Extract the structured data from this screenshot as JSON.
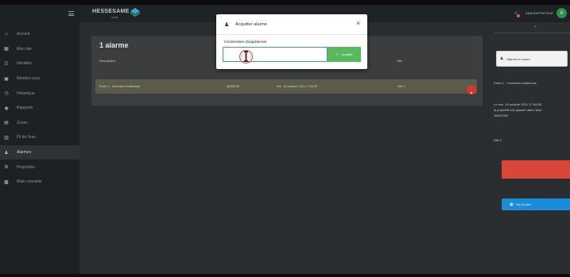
{
  "app": {
    "logo": "HESSESAME",
    "logo_sub": "CUBE"
  },
  "user": {
    "name": "ADMINISTRATEUR",
    "avatar_initial": "A"
  },
  "sidebar": {
    "items": [
      {
        "label": "Accueil",
        "icon": "home-icon",
        "glyph": "⌂",
        "active": false
      },
      {
        "label": "Mon site",
        "icon": "building-icon",
        "glyph": "▦",
        "active": false
      },
      {
        "label": "Identités",
        "icon": "users-icon",
        "glyph": "☷",
        "active": false
      },
      {
        "label": "Rendez-vous",
        "icon": "calendar-icon",
        "glyph": "▣",
        "active": false
      },
      {
        "label": "Historique",
        "icon": "history-icon",
        "glyph": "◷",
        "active": false
      },
      {
        "label": "Rapports",
        "icon": "reports-icon",
        "glyph": "◉",
        "active": false
      },
      {
        "label": "Zones",
        "icon": "zones-icon",
        "glyph": "▤",
        "active": false
      },
      {
        "label": "Fil de l'eau",
        "icon": "feed-icon",
        "glyph": "▥",
        "active": false
      },
      {
        "label": "Alarmes",
        "icon": "alarm-icon",
        "glyph": "♟",
        "active": true
      },
      {
        "label": "Propriétés",
        "icon": "properties-icon",
        "glyph": "⚙",
        "active": false
      },
      {
        "label": "Main courante",
        "icon": "logbook-icon",
        "glyph": "▩",
        "active": false
      }
    ]
  },
  "main": {
    "title": "1 alarme",
    "columns": {
      "description": "Description",
      "site": "Site"
    },
    "rows": [
      {
        "description": "Porte 1 - Ouverture inattendue",
        "status": "MARCHE",
        "date": "ven. 15 octobre 2021 17:04:59",
        "site": "Site 2"
      }
    ]
  },
  "right_panel": {
    "box_label": "Alarme en cours",
    "alarm_name": "Porte 1 - Ouverture inattendue",
    "detail_1": "Le ven. 15 octobre 2021 17:04:59",
    "detail_2": "la propriété est passée dans l'état",
    "detail_3": "'MARCHE'",
    "site": "Site 2",
    "blue_button": "Voir la vidéo"
  },
  "modal": {
    "title": "Acquitter alarme",
    "close": "×",
    "comment_label": "Commentaire d'acquittement",
    "comment_value": "",
    "submit_label": "Acquitter"
  },
  "colors": {
    "accent_green": "#5cb85c",
    "danger_red": "#d33a2c",
    "info_blue": "#1a8cd8",
    "avatar_green": "#2f8f4e"
  }
}
